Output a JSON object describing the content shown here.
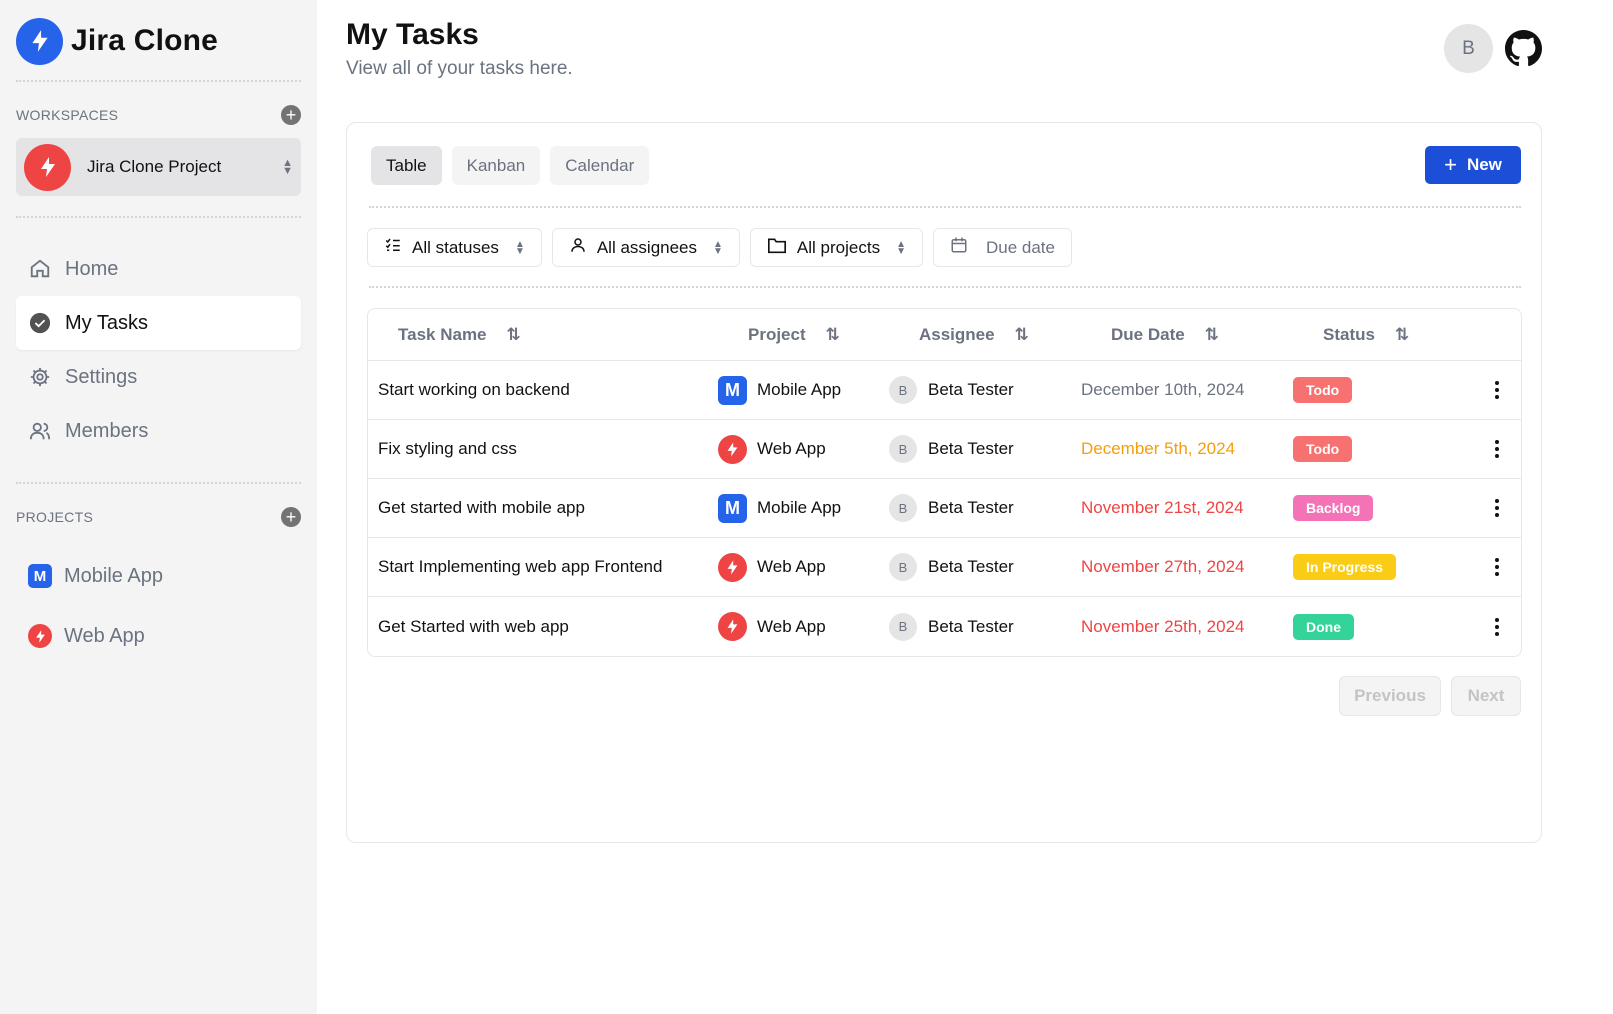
{
  "app": {
    "name": "Jira Clone",
    "brand_color": "#2563eb"
  },
  "sidebar": {
    "workspaces_label": "WORKSPACES",
    "workspace": {
      "name": "Jira Clone Project",
      "color": "#ef4444"
    },
    "nav": [
      {
        "label": "Home",
        "icon": "home-icon",
        "active": false
      },
      {
        "label": "My Tasks",
        "icon": "check-circle-icon",
        "active": true
      },
      {
        "label": "Settings",
        "icon": "gear-icon",
        "active": false
      },
      {
        "label": "Members",
        "icon": "users-icon",
        "active": false
      }
    ],
    "projects_label": "PROJECTS",
    "projects": [
      {
        "label": "Mobile App",
        "icon_letter": "M"
      },
      {
        "label": "Web App",
        "icon": "bolt-icon"
      }
    ]
  },
  "header": {
    "title": "My Tasks",
    "subtitle": "View all of your tasks here.",
    "user_initial": "B"
  },
  "view_tabs": [
    {
      "label": "Table",
      "active": true
    },
    {
      "label": "Kanban",
      "active": false
    },
    {
      "label": "Calendar",
      "active": false
    }
  ],
  "new_button": {
    "label": "New"
  },
  "filters": {
    "status": "All statuses",
    "assignee": "All assignees",
    "project": "All projects",
    "due_date_placeholder": "Due date"
  },
  "table": {
    "columns": [
      "Task Name",
      "Project",
      "Assignee",
      "Due Date",
      "Status"
    ],
    "rows": [
      {
        "name": "Start working on backend",
        "project": "Mobile App",
        "project_type": "mobile",
        "assignee_initial": "B",
        "assignee": "Beta Tester",
        "due": "December 10th, 2024",
        "due_color": "#6b7280",
        "status": "Todo",
        "status_color": "#f87171"
      },
      {
        "name": "Fix styling and css",
        "project": "Web App",
        "project_type": "web",
        "assignee_initial": "B",
        "assignee": "Beta Tester",
        "due": "December 5th, 2024",
        "due_color": "#f59e0b",
        "status": "Todo",
        "status_color": "#f87171"
      },
      {
        "name": "Get started with mobile app",
        "project": "Mobile App",
        "project_type": "mobile",
        "assignee_initial": "B",
        "assignee": "Beta Tester",
        "due": "November 21st, 2024",
        "due_color": "#ef4444",
        "status": "Backlog",
        "status_color": "#f472b6"
      },
      {
        "name": "Start Implementing web app Frontend",
        "project": "Web App",
        "project_type": "web",
        "assignee_initial": "B",
        "assignee": "Beta Tester",
        "due": "November 27th, 2024",
        "due_color": "#ef4444",
        "status": "In Progress",
        "status_color": "#facc15"
      },
      {
        "name": "Get Started with web app",
        "project": "Web App",
        "project_type": "web",
        "assignee_initial": "B",
        "assignee": "Beta Tester",
        "due": "November 25th, 2024",
        "due_color": "#ef4444",
        "status": "Done",
        "status_color": "#34d399"
      }
    ]
  },
  "pagination": {
    "previous": "Previous",
    "next": "Next"
  }
}
